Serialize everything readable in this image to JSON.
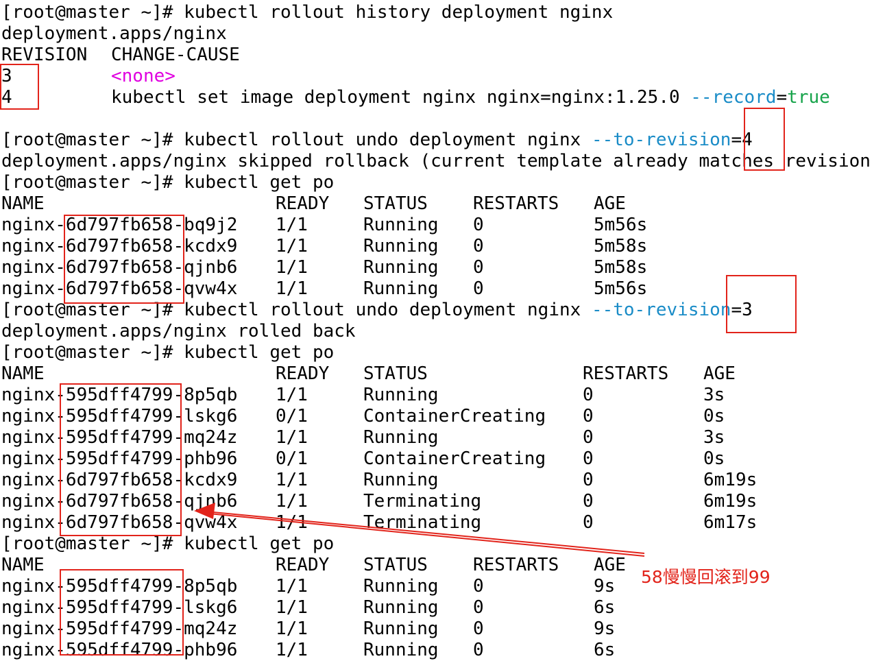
{
  "terminal": {
    "prompt": "[root@master ~]# ",
    "history_cmd": "kubectl rollout history deployment nginx",
    "history_output": "deployment.apps/nginx",
    "history_header": {
      "revision": "REVISION",
      "change_cause": "CHANGE-CAUSE"
    },
    "revisions": [
      {
        "num": "3",
        "cause_none": "<none>"
      },
      {
        "num": "4",
        "cause_prefix": "kubectl set image deployment nginx nginx=nginx:1.25.0 ",
        "cause_flag": "--record",
        "cause_eq": "=",
        "cause_val": "true"
      }
    ],
    "undo4": {
      "cmd": "kubectl rollout undo deployment nginx ",
      "flag": "--to-revision",
      "value": "=4"
    },
    "undo4_output": "deployment.apps/nginx skipped rollback (current template already matches revision",
    "get_po_cmd": "kubectl get po",
    "table_headers": {
      "name": "NAME",
      "ready": "READY",
      "status": "STATUS",
      "restarts": "RESTARTS",
      "age": "AGE"
    },
    "pods_1": [
      {
        "name": "nginx-6d797fb658-bq9j2",
        "ready": "1/1",
        "status": "Running",
        "restarts": "0",
        "age": "5m56s"
      },
      {
        "name": "nginx-6d797fb658-kcdx9",
        "ready": "1/1",
        "status": "Running",
        "restarts": "0",
        "age": "5m58s"
      },
      {
        "name": "nginx-6d797fb658-qjnb6",
        "ready": "1/1",
        "status": "Running",
        "restarts": "0",
        "age": "5m58s"
      },
      {
        "name": "nginx-6d797fb658-qvw4x",
        "ready": "1/1",
        "status": "Running",
        "restarts": "0",
        "age": "5m56s"
      }
    ],
    "undo3": {
      "cmd": "kubectl rollout undo deployment nginx ",
      "flag": "--to-revision",
      "value": "=3"
    },
    "undo3_output": "deployment.apps/nginx rolled back",
    "pods_2": [
      {
        "name": "nginx-595dff4799-8p5qb",
        "ready": "1/1",
        "status": "Running",
        "restarts": "0",
        "age": "3s"
      },
      {
        "name": "nginx-595dff4799-lskg6",
        "ready": "0/1",
        "status": "ContainerCreating",
        "restarts": "0",
        "age": "0s"
      },
      {
        "name": "nginx-595dff4799-mq24z",
        "ready": "1/1",
        "status": "Running",
        "restarts": "0",
        "age": "3s"
      },
      {
        "name": "nginx-595dff4799-phb96",
        "ready": "0/1",
        "status": "ContainerCreating",
        "restarts": "0",
        "age": "0s"
      },
      {
        "name": "nginx-6d797fb658-kcdx9",
        "ready": "1/1",
        "status": "Running",
        "restarts": "0",
        "age": "6m19s"
      },
      {
        "name": "nginx-6d797fb658-qjnb6",
        "ready": "1/1",
        "status": "Terminating",
        "restarts": "0",
        "age": "6m19s"
      },
      {
        "name": "nginx-6d797fb658-qvw4x",
        "ready": "1/1",
        "status": "Terminating",
        "restarts": "0",
        "age": "6m17s"
      }
    ],
    "pods_3": [
      {
        "name": "nginx-595dff4799-8p5qb",
        "ready": "1/1",
        "status": "Running",
        "restarts": "0",
        "age": "9s"
      },
      {
        "name": "nginx-595dff4799-lskg6",
        "ready": "1/1",
        "status": "Running",
        "restarts": "0",
        "age": "6s"
      },
      {
        "name": "nginx-595dff4799-mq24z",
        "ready": "1/1",
        "status": "Running",
        "restarts": "0",
        "age": "9s"
      },
      {
        "name": "nginx-595dff4799-phb96",
        "ready": "1/1",
        "status": "Running",
        "restarts": "0",
        "age": "6s"
      }
    ]
  },
  "annotation": {
    "text": "58慢慢回滚到99",
    "color": "#e2231a"
  }
}
